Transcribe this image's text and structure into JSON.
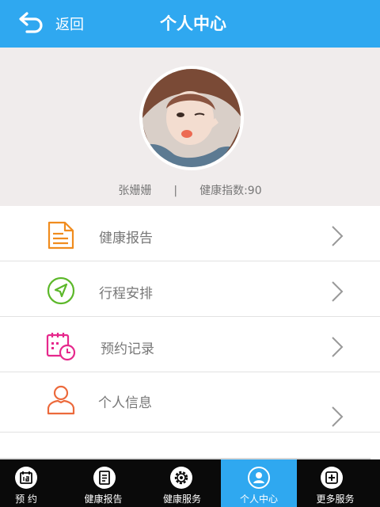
{
  "header": {
    "back_icon": "back-arrow-icon",
    "back_label": "返回",
    "title": "个人中心"
  },
  "profile": {
    "name": "张姗姗",
    "separator": "|",
    "health_index": "健康指数:90"
  },
  "menu": [
    {
      "label": "健康报告",
      "icon": "health-report-icon",
      "color": "#f08c1e"
    },
    {
      "label": "行程安排",
      "icon": "navigation-icon",
      "color": "#5cb82a"
    },
    {
      "label": "预约记录",
      "icon": "calendar-clock-icon",
      "color": "#e6288c"
    },
    {
      "label": "个人信息",
      "icon": "person-icon",
      "color": "#ec6a3c"
    }
  ],
  "tabs": [
    {
      "label": "预  约",
      "icon": "appointment-icon",
      "active": false
    },
    {
      "label": "健康报告",
      "icon": "report-icon",
      "active": false
    },
    {
      "label": "健康服务",
      "icon": "gear-icon",
      "active": false
    },
    {
      "label": "个人中心",
      "icon": "user-icon",
      "active": true
    },
    {
      "label": "更多服务",
      "icon": "more-icon",
      "active": false
    }
  ],
  "colors": {
    "header_bg": "#2fa8f0",
    "profile_bg": "#f0ecec",
    "tabbar_bg": "#0a0a0a",
    "active_tab_bg": "#2fa8f0"
  }
}
